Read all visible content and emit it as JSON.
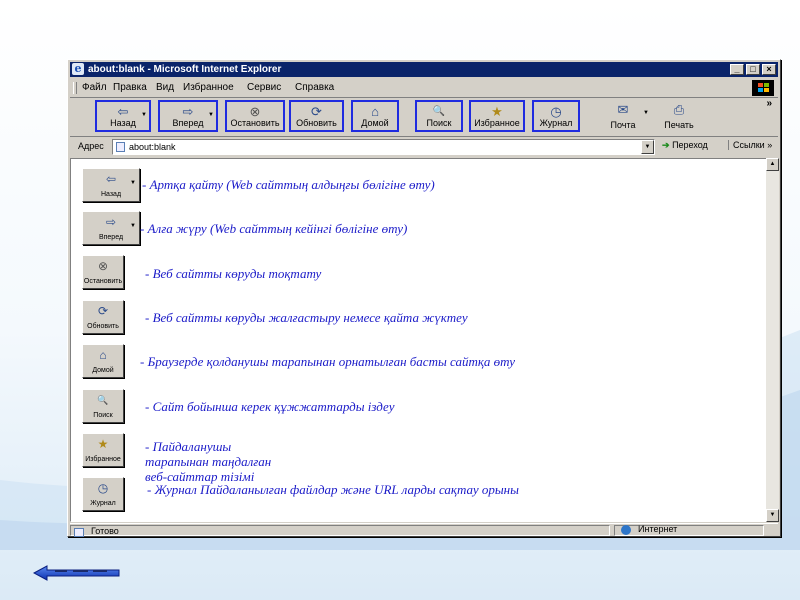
{
  "window": {
    "title": "about:blank - Microsoft Internet Explorer",
    "controls": {
      "minimize": "_",
      "maximize": "□",
      "close": "×"
    }
  },
  "menu": [
    "Файл",
    "Правка",
    "Вид",
    "Избранное",
    "Сервис",
    "Справка"
  ],
  "toolbar": {
    "buttons": [
      {
        "label": "Назад",
        "icon": "back-arrow-icon",
        "glyph": "⇦",
        "highlighted": true,
        "dropdown": true
      },
      {
        "label": "Вперед",
        "icon": "forward-arrow-icon",
        "glyph": "⇨",
        "highlighted": true,
        "dropdown": true
      },
      {
        "label": "Остановить",
        "icon": "stop-icon",
        "glyph": "⊗",
        "highlighted": true
      },
      {
        "label": "Обновить",
        "icon": "refresh-icon",
        "glyph": "⟳",
        "highlighted": true
      },
      {
        "label": "Домой",
        "icon": "home-icon",
        "glyph": "⌂",
        "highlighted": true
      },
      {
        "label": "Поиск",
        "icon": "search-icon",
        "glyph": "🔍",
        "highlighted": true
      },
      {
        "label": "Избранное",
        "icon": "favorites-icon",
        "glyph": "★",
        "highlighted": true
      },
      {
        "label": "Журнал",
        "icon": "history-icon",
        "glyph": "◷",
        "highlighted": true
      },
      {
        "label": "Почта",
        "icon": "mail-icon",
        "glyph": "✉",
        "highlighted": false,
        "dropdown": true
      },
      {
        "label": "Печать",
        "icon": "print-icon",
        "glyph": "⎙",
        "highlighted": false
      }
    ],
    "more": "»"
  },
  "address": {
    "label": "Адрес",
    "value": "about:blank",
    "go_label": "Переход",
    "links_label": "Ссылки"
  },
  "legend": [
    {
      "button": "Назад",
      "icon": "back-arrow-icon",
      "glyph": "⇦",
      "dropdown": true,
      "text": "- Артқа қайту (Web сайттың алдыңғы бөлігіне өту)"
    },
    {
      "button": "Вперед",
      "icon": "forward-arrow-icon",
      "glyph": "⇨",
      "dropdown": true,
      "text": "- Алға жүру (Web сайттың кейінгі бөлігіне өту)"
    },
    {
      "button": "Остановить",
      "icon": "stop-icon",
      "glyph": "⊗",
      "text": "- Веб сайтты көруды тоқтату"
    },
    {
      "button": "Обновить",
      "icon": "refresh-icon",
      "glyph": "⟳",
      "text": "- Веб сайтты көруды жалғастыру немесе қайта жүктеу"
    },
    {
      "button": "Домой",
      "icon": "home-icon",
      "glyph": "⌂",
      "text": "- Браузерде қолданушы тарапынан орнатылған басты сайтқа өту"
    },
    {
      "button": "Поиск",
      "icon": "search-icon",
      "glyph": "🔍",
      "text": "- Сайт бойынша керек құжжаттарды іздеу"
    },
    {
      "button": "Избранное",
      "icon": "favorites-icon",
      "glyph": "★",
      "text": "- Пайдаланушы тарапынан таңдалған веб-сайттар тізімі"
    },
    {
      "button": "Журнал",
      "icon": "history-icon",
      "glyph": "◷",
      "text": "- Журнал Пайдаланылған файлдар және URL ларды сақтау орыны"
    }
  ],
  "status": {
    "text": "Готово",
    "zone": "Интернет"
  },
  "colors": {
    "titlebar": "#0a246a",
    "highlight_border": "#1f2be0",
    "legend_text": "#1a1ac8",
    "chrome": "#d4d0c8"
  }
}
